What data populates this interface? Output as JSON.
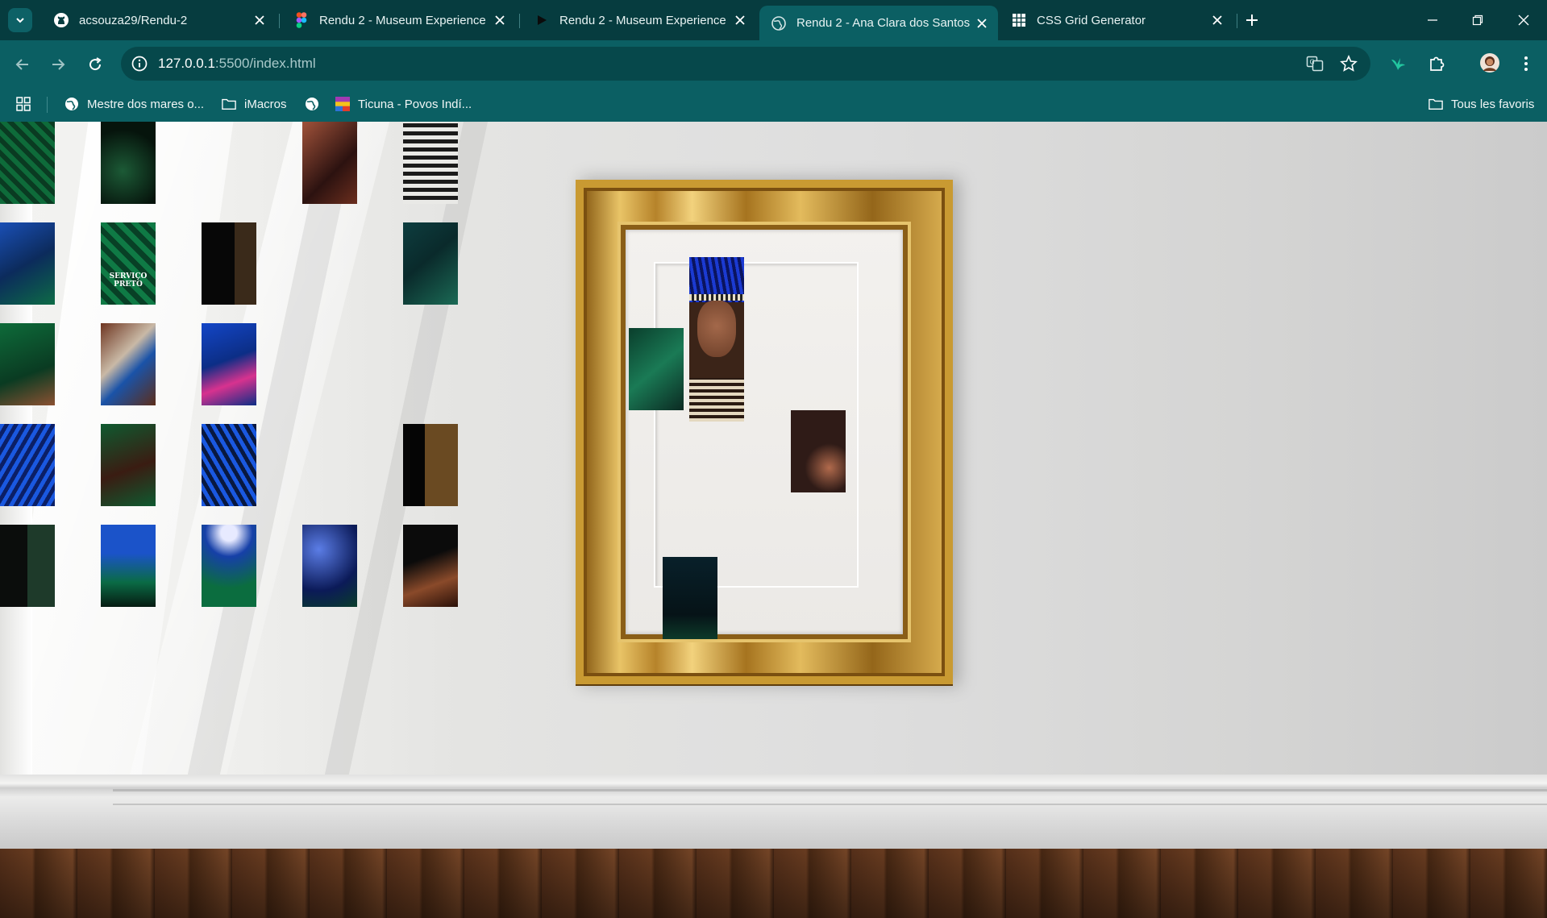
{
  "tabs": [
    {
      "title": "acsouza29/Rendu-2",
      "favicon": "github-icon"
    },
    {
      "title": "Rendu 2 - Museum Experience",
      "favicon": "figma-icon"
    },
    {
      "title": "Rendu 2 - Museum Experience",
      "favicon": "play-icon"
    },
    {
      "title": "Rendu 2 - Ana Clara dos Santos",
      "favicon": "globe-icon",
      "active": true
    },
    {
      "title": "CSS Grid Generator",
      "favicon": "grid-icon"
    }
  ],
  "address_bar": {
    "host": "127.0.0.1",
    "rest": ":5500/index.html"
  },
  "bookmarks": [
    {
      "label": "Mestre dos mares o...",
      "icon": "globe-icon"
    },
    {
      "label": "iMacros",
      "icon": "folder-icon"
    },
    {
      "label": "",
      "icon": "globe-icon"
    },
    {
      "label": "Ticuna - Povos Indí...",
      "icon": "site-favicon"
    }
  ],
  "bookmarks_right": {
    "label": "Tous les favoris",
    "icon": "folder-icon"
  },
  "colors": {
    "chrome_dark": "#063c3f",
    "chrome": "#0b5f63",
    "omnibox": "#06484b",
    "frame_gold": "#c99a32"
  },
  "gallery": {
    "tiles": [
      {
        "id": "t-r1c1",
        "palette": "green-pattern"
      },
      {
        "id": "t-r1c2",
        "palette": "dark-green"
      },
      {
        "id": "t-r1c4",
        "palette": "skin-tattoo"
      },
      {
        "id": "t-r1c5",
        "palette": "black-white-pattern"
      },
      {
        "id": "t-r2c1",
        "palette": "blue-leaf"
      },
      {
        "id": "t-r2c2",
        "palette": "green-label"
      },
      {
        "id": "t-r2c3",
        "palette": "dark-wood"
      },
      {
        "id": "t-r2c5",
        "palette": "teal-leaf"
      },
      {
        "id": "t-r3c1",
        "palette": "green-hand"
      },
      {
        "id": "t-r3c2",
        "palette": "skin-beads"
      },
      {
        "id": "t-r3c3",
        "palette": "blue-pink"
      },
      {
        "id": "t-r4c1",
        "palette": "blue-feathers"
      },
      {
        "id": "t-r4c2",
        "palette": "green-skin"
      },
      {
        "id": "t-r4c3",
        "palette": "blue-feathers-dark"
      },
      {
        "id": "t-r4c5",
        "palette": "wood-yellow"
      },
      {
        "id": "t-r5c1",
        "palette": "dark-fabric"
      },
      {
        "id": "t-r5c2",
        "palette": "blue-sky-green"
      },
      {
        "id": "t-r5c3",
        "palette": "green-pattern-arc"
      },
      {
        "id": "t-r5c4",
        "palette": "blue-space"
      },
      {
        "id": "t-r5c5",
        "palette": "dark-skin"
      }
    ],
    "tile_label": "SERVIÇO PRETO"
  }
}
